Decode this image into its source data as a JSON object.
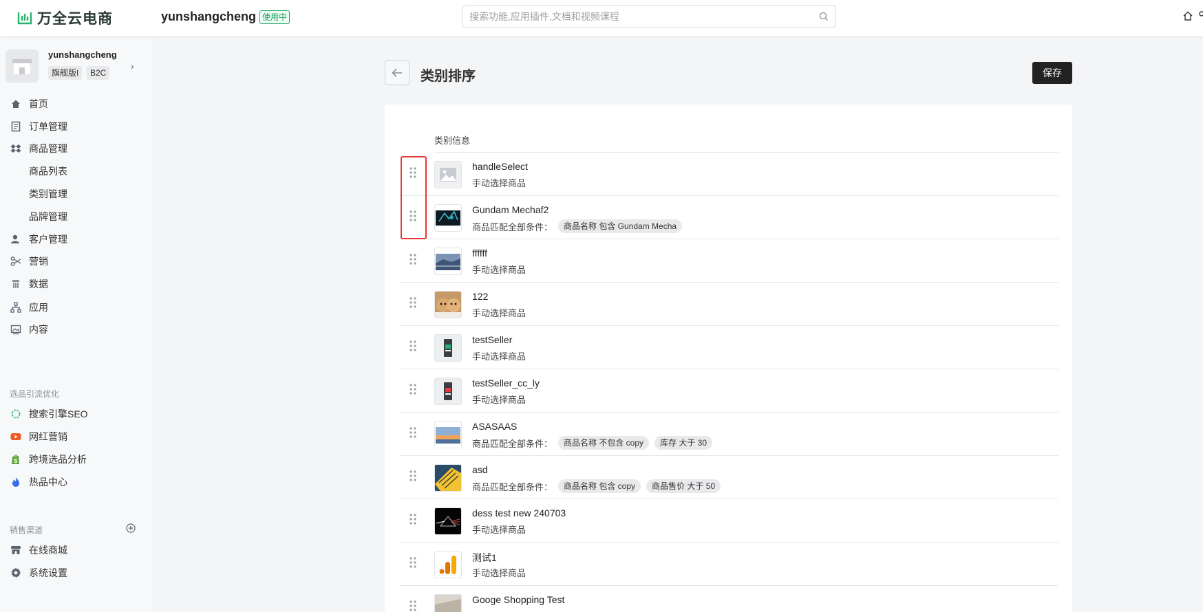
{
  "header": {
    "logo_text": "万全云电商",
    "shop_name": "yunshangcheng",
    "status_badge": "使用中",
    "search_placeholder": "搜索功能,应用插件,文档和视频课程"
  },
  "sidebar": {
    "store": {
      "name": "yunshangcheng",
      "tags": [
        "旗舰版I",
        "B2C"
      ]
    },
    "nav": [
      {
        "label": "首页",
        "icon": "home-icon"
      },
      {
        "label": "订单管理",
        "icon": "order-icon"
      },
      {
        "label": "商品管理",
        "icon": "dropbox-icon"
      },
      {
        "label": "商品列表",
        "sub": true
      },
      {
        "label": "类别管理",
        "sub": true
      },
      {
        "label": "品牌管理",
        "sub": true
      },
      {
        "label": "客户管理",
        "icon": "customer-icon"
      },
      {
        "label": "营销",
        "icon": "scissors-icon"
      },
      {
        "label": "数据",
        "icon": "data-icon"
      },
      {
        "label": "应用",
        "icon": "sitemap-icon"
      },
      {
        "label": "内容",
        "icon": "image-icon"
      }
    ],
    "section1_label": "选品引流优化",
    "section1_items": [
      {
        "label": "搜索引擎SEO",
        "icon": "seo-icon",
        "color": "#4cc38a"
      },
      {
        "label": "网红营销",
        "icon": "youtube-icon",
        "color": "#f05a22"
      },
      {
        "label": "跨境选品分析",
        "icon": "shopify-icon",
        "color": "#5fa83c"
      },
      {
        "label": "热品中心",
        "icon": "flame-icon",
        "color": "#3b6be8"
      }
    ],
    "section2_label": "销售渠道",
    "section2_items": [
      {
        "label": "在线商城",
        "icon": "store-icon"
      },
      {
        "label": "系统设置",
        "icon": "gear-icon"
      }
    ]
  },
  "page": {
    "title": "类别排序",
    "save_label": "保存",
    "column_header": "类别信息"
  },
  "categories": [
    {
      "name": "handleSelect",
      "desc": "手动选择商品",
      "tags": []
    },
    {
      "name": "Gundam Mechaf2",
      "desc": "商品匹配全部条件：",
      "tags": [
        "商品名称 包含 Gundam Mecha"
      ]
    },
    {
      "name": "ffffff",
      "desc": "手动选择商品",
      "tags": []
    },
    {
      "name": "122",
      "desc": "手动选择商品",
      "tags": []
    },
    {
      "name": "testSeller",
      "desc": "手动选择商品",
      "tags": []
    },
    {
      "name": "testSeller_cc_ly",
      "desc": "手动选择商品",
      "tags": []
    },
    {
      "name": "ASASAAS",
      "desc": "商品匹配全部条件：",
      "tags": [
        "商品名称 不包含 copy",
        "库存 大于 30"
      ]
    },
    {
      "name": "asd",
      "desc": "商品匹配全部条件：",
      "tags": [
        "商品名称 包含 copy",
        "商品售价 大于 50"
      ]
    },
    {
      "name": "dess test new 240703",
      "desc": "手动选择商品",
      "tags": []
    },
    {
      "name": "测试1",
      "desc": "手动选择商品",
      "tags": []
    },
    {
      "name": "Googe Shopping Test",
      "desc": "",
      "tags": []
    }
  ],
  "colors": {
    "accent_green": "#1aa760",
    "highlight_red": "#e53935",
    "save_bg": "#222222"
  }
}
